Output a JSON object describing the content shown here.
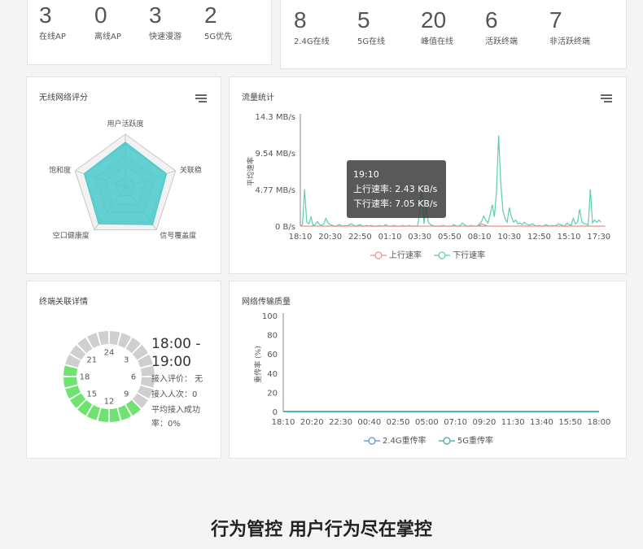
{
  "ap_stats": [
    {
      "value": "3",
      "label": "在线AP"
    },
    {
      "value": "0",
      "label": "离线AP"
    },
    {
      "value": "3",
      "label": "快速漫游"
    },
    {
      "value": "2",
      "label": "5G优先"
    }
  ],
  "client_stats": [
    {
      "value": "8",
      "label": "2.4G在线"
    },
    {
      "value": "5",
      "label": "5G在线"
    },
    {
      "value": "20",
      "label": "峰值在线"
    },
    {
      "value": "6",
      "label": "活跃终端"
    },
    {
      "value": "7",
      "label": "非活跃终端"
    }
  ],
  "wireless_score": {
    "title": "无线网络评分",
    "menu_icon": "hamburger-icon",
    "chart_data": {
      "type": "radar",
      "axes": [
        "用户活跃度",
        "关联稳",
        "信号覆盖度",
        "空口健康度",
        "饱和度"
      ],
      "values": [
        0.85,
        0.82,
        0.88,
        0.86,
        0.82
      ],
      "max": 1,
      "color": "#48c9c9"
    }
  },
  "traffic": {
    "title": "流量统计",
    "menu_icon": "hamburger-icon",
    "chart_data": {
      "type": "line",
      "ylabel": "平均速率",
      "yticks": [
        "14.3 MB/s",
        "9.54 MB/s",
        "4.77 MB/s",
        "0 B/s"
      ],
      "ytick_values": [
        14.3,
        9.54,
        4.77,
        0
      ],
      "ylim": [
        0,
        14.3
      ],
      "x": [
        "18:10",
        "18:20",
        "18:30",
        "18:40",
        "18:50",
        "19:00",
        "19:10",
        "19:20",
        "19:30",
        "19:40",
        "19:50",
        "20:00",
        "20:10",
        "20:20",
        "20:30",
        "20:40",
        "20:50",
        "21:00",
        "21:10",
        "21:20",
        "21:30",
        "21:40",
        "21:50",
        "22:00",
        "22:10",
        "22:20",
        "22:30",
        "22:40",
        "22:50",
        "23:00",
        "23:10",
        "23:20",
        "23:30",
        "23:40",
        "23:50",
        "00:00",
        "00:10",
        "00:20",
        "00:30",
        "00:40",
        "00:50",
        "01:00",
        "01:10",
        "01:20",
        "01:30",
        "01:40",
        "01:50",
        "02:00",
        "02:10",
        "02:20",
        "02:30",
        "02:40",
        "02:50",
        "03:00",
        "03:10",
        "03:20",
        "03:30",
        "03:40",
        "03:50",
        "04:00",
        "04:10",
        "04:20",
        "04:30",
        "04:40",
        "04:50",
        "05:00",
        "05:10",
        "05:20",
        "05:30",
        "05:40",
        "05:50",
        "06:00",
        "06:10",
        "06:20",
        "06:30",
        "06:40",
        "06:50",
        "07:00",
        "07:10",
        "07:20",
        "07:30",
        "07:40",
        "07:50",
        "08:00",
        "08:10",
        "08:20",
        "08:30",
        "08:40",
        "08:50",
        "09:00",
        "09:10",
        "09:20",
        "09:30",
        "09:40",
        "09:50",
        "10:00",
        "10:10",
        "10:20",
        "10:30",
        "10:40",
        "10:50",
        "11:00",
        "11:10",
        "11:20",
        "11:30",
        "11:40",
        "11:50",
        "12:00",
        "12:10",
        "12:20",
        "12:30",
        "12:40",
        "12:50",
        "13:00",
        "13:10",
        "13:20",
        "13:30",
        "13:40",
        "13:50",
        "14:00",
        "14:10",
        "14:20",
        "14:30",
        "14:40",
        "14:50",
        "15:00",
        "15:10",
        "15:20",
        "15:30",
        "15:40",
        "15:50",
        "16:00",
        "16:10",
        "16:20",
        "16:30",
        "16:40",
        "16:50",
        "17:00",
        "17:10",
        "17:20",
        "17:30",
        "17:40",
        "17:50"
      ],
      "xticks": [
        "18:10",
        "20:30",
        "22:50",
        "01:10",
        "03:30",
        "05:50",
        "08:10",
        "10:30",
        "12:50",
        "15:10",
        "17:30"
      ],
      "series": [
        {
          "name": "上行速率",
          "color": "#f08c8c",
          "values": [
            0,
            0,
            0,
            0,
            0,
            0,
            0.05,
            0.02,
            0,
            0,
            0,
            0,
            0,
            0.01,
            0,
            0,
            0,
            0,
            0,
            0,
            0,
            0.01,
            0,
            0,
            0,
            0,
            0,
            0,
            0,
            0,
            0,
            0,
            0,
            0.01,
            0,
            0,
            0,
            0,
            0,
            0,
            0,
            0,
            0,
            0,
            0,
            0,
            0,
            0,
            0,
            0,
            0,
            0,
            0,
            0,
            0,
            0,
            0,
            0,
            0,
            0,
            0,
            0,
            0,
            0,
            0,
            0,
            0,
            0,
            0,
            0,
            0,
            0,
            0,
            0,
            0,
            0,
            0.02,
            0,
            0,
            0,
            0,
            0,
            0,
            0,
            0.1,
            0.3,
            0.2,
            0.1,
            0,
            0,
            0,
            0,
            0,
            0,
            0,
            0,
            0,
            0,
            0,
            0,
            0,
            0,
            0,
            0,
            0,
            0,
            0,
            0,
            0,
            0,
            0,
            0,
            0,
            0,
            0,
            0,
            0,
            0,
            0,
            0,
            0,
            0,
            0,
            0,
            0,
            0,
            0,
            0,
            0,
            0,
            0,
            0,
            0,
            0,
            0,
            0,
            0,
            0,
            0,
            0,
            0,
            0,
            0,
            0
          ]
        },
        {
          "name": "下行速率",
          "color": "#5ccfa9",
          "values": [
            0,
            0.2,
            4.8,
            0.5,
            0.3,
            1.2,
            0.1,
            0.2,
            0.6,
            0.2,
            0.1,
            0.3,
            1.0,
            0.4,
            0.2,
            0.1,
            0,
            0,
            0.2,
            0.1,
            0,
            0.1,
            0,
            0.2,
            0.3,
            0.1,
            0,
            0.1,
            0.2,
            0,
            0,
            0.1,
            0,
            0.1,
            0,
            0,
            0,
            0.1,
            0,
            0,
            0.2,
            0,
            0,
            0,
            0.1,
            0,
            0,
            0,
            0.1,
            0,
            0,
            0.1,
            0,
            0,
            0,
            0,
            2.0,
            5.2,
            0.3,
            2.5,
            0.5,
            0.2,
            0.1,
            0,
            0,
            0,
            0,
            0.1,
            0,
            0,
            0,
            0,
            0.2,
            0,
            0,
            0.1,
            0.4,
            0.2,
            0,
            0,
            0.1,
            0,
            0,
            0,
            0.3,
            0.6,
            1.3,
            0.8,
            0.4,
            1.5,
            2.8,
            1.2,
            4.5,
            11.8,
            5.5,
            2.0,
            1.0,
            0.5,
            2.4,
            1.2,
            0.5,
            0.8,
            0.3,
            0.4,
            0.2,
            0.5,
            0.3,
            0.1,
            0.2,
            0.3,
            0.1,
            0,
            0.1,
            0,
            0,
            0.2,
            0.1,
            0,
            0.1,
            0,
            0.1,
            0.3,
            0.2,
            0.1,
            0,
            0.4,
            0.2,
            0.1,
            1.0,
            0.3,
            0.5,
            2.2,
            0.6,
            0.3,
            0.3,
            0.1,
            4.8,
            0.4,
            0.8,
            0.5,
            0.8,
            0.5
          ]
        }
      ]
    },
    "tooltip": {
      "time": "19:10",
      "up": "上行速率: 2.43 KB/s",
      "down": "下行速率: 7.05 KB/s"
    }
  },
  "terminal": {
    "title": "终端关联详情",
    "clock_labels": [
      "24",
      "3",
      "6",
      "9",
      "12",
      "15",
      "18",
      "21"
    ],
    "active_color": "#6fe36f",
    "inactive_color": "#cfcfcf",
    "active_segments": [
      9,
      10,
      11,
      12,
      13,
      14,
      15,
      16,
      17,
      18
    ],
    "segment_count": 24,
    "time_range_start": "18:00 -",
    "time_range_end": "19:00",
    "eval": "接入评价： 无",
    "count": "接入人次：0",
    "rate": "平均接入成功率：0%"
  },
  "quality": {
    "title": "网络传输质量",
    "chart_data": {
      "type": "line",
      "ylabel": "重传率 (%)",
      "yticks": [
        "100",
        "80",
        "60",
        "40",
        "20",
        "0"
      ],
      "ytick_values": [
        100,
        80,
        60,
        40,
        20,
        0
      ],
      "ylim": [
        0,
        100
      ],
      "xticks": [
        "18:10",
        "20:20",
        "22:30",
        "00:40",
        "02:50",
        "05:00",
        "07:10",
        "09:20",
        "11:30",
        "13:40",
        "15:50",
        "18:00"
      ],
      "series": [
        {
          "name": "2.4G重传率",
          "color": "#5b8fd6",
          "values": [
            0,
            0,
            0,
            0,
            0,
            0,
            0,
            0,
            0,
            0,
            0,
            0
          ]
        },
        {
          "name": "5G重传率",
          "color": "#3aaba0",
          "values": [
            0,
            0,
            0,
            0,
            0,
            0,
            0,
            0,
            0,
            0,
            0,
            0
          ]
        }
      ]
    }
  },
  "banner": "行为管控 用户行为尽在掌控"
}
